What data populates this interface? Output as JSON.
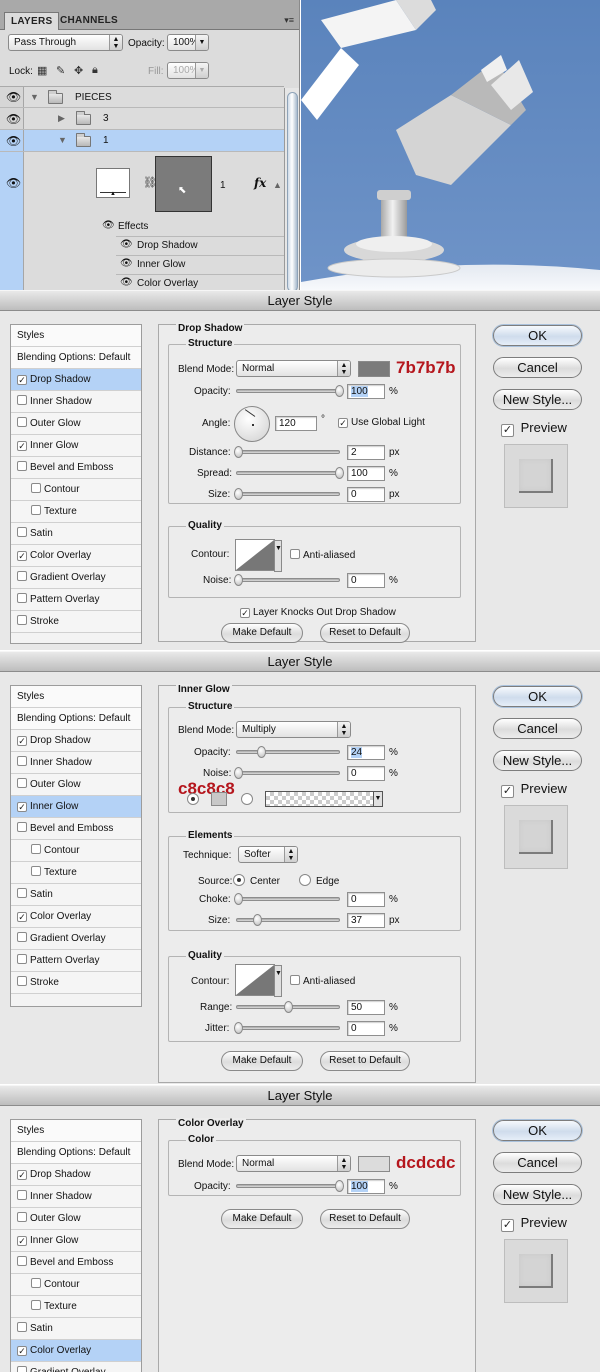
{
  "layers_panel": {
    "tabs": [
      "LAYERS",
      "CHANNELS"
    ],
    "menu_icon": "▾≡",
    "blend_mode": "Pass Through",
    "opacity_label": "Opacity:",
    "opacity_value": "100%",
    "lock_label": "Lock:",
    "fill_label": "Fill:",
    "fill_value": "100%",
    "layers": [
      {
        "name": "PIECES"
      },
      {
        "name": "3"
      },
      {
        "name": "1"
      },
      {
        "name": "1"
      }
    ],
    "effects_label": "Effects",
    "effects": [
      "Drop Shadow",
      "Inner Glow",
      "Color Overlay"
    ],
    "fx_label": "fx"
  },
  "styles_list": [
    {
      "label": "Styles",
      "checkbox": false
    },
    {
      "label": "Blending Options: Default",
      "checkbox": false
    },
    {
      "label": "Drop Shadow",
      "checkbox": true
    },
    {
      "label": "Inner Shadow",
      "checkbox": true
    },
    {
      "label": "Outer Glow",
      "checkbox": true
    },
    {
      "label": "Inner Glow",
      "checkbox": true
    },
    {
      "label": "Bevel and Emboss",
      "checkbox": true
    },
    {
      "label": "Contour",
      "checkbox": true,
      "indent": true
    },
    {
      "label": "Texture",
      "checkbox": true,
      "indent": true
    },
    {
      "label": "Satin",
      "checkbox": true
    },
    {
      "label": "Color Overlay",
      "checkbox": true
    },
    {
      "label": "Gradient Overlay",
      "checkbox": true
    },
    {
      "label": "Pattern Overlay",
      "checkbox": true
    },
    {
      "label": "Stroke",
      "checkbox": true
    }
  ],
  "checked_styles": [
    "Drop Shadow",
    "Inner Glow",
    "Color Overlay"
  ],
  "side_buttons": {
    "ok": "OK",
    "cancel": "Cancel",
    "new_style": "New Style...",
    "preview": "Preview"
  },
  "common": {
    "make_default": "Make Default",
    "reset_default": "Reset to Default",
    "check_mark": "✓"
  },
  "dialog1": {
    "title": "Layer Style",
    "section": "Drop Shadow",
    "structure": "Structure",
    "blend_mode_label": "Blend Mode:",
    "blend_mode": "Normal",
    "swatch_color": "#7b7b7b",
    "annotation": "7b7b7b",
    "opacity_label": "Opacity:",
    "opacity": "100",
    "angle_label": "Angle:",
    "angle": "120",
    "degree": "°",
    "use_global_light": "Use Global Light",
    "distance_label": "Distance:",
    "distance": "2",
    "spread_label": "Spread:",
    "spread": "100",
    "size_label": "Size:",
    "size": "0",
    "quality": "Quality",
    "contour_label": "Contour:",
    "anti_aliased": "Anti-aliased",
    "noise_label": "Noise:",
    "noise": "0",
    "knocks_out": "Layer Knocks Out Drop Shadow",
    "units": {
      "pct": "%",
      "px": "px"
    }
  },
  "dialog2": {
    "title": "Layer Style",
    "section": "Inner Glow",
    "structure": "Structure",
    "blend_mode_label": "Blend Mode:",
    "blend_mode": "Multiply",
    "opacity_label": "Opacity:",
    "opacity": "24",
    "noise_label": "Noise:",
    "noise": "0",
    "annotation": "c8c8c8",
    "swatch_color": "#c8c8c8",
    "elements": "Elements",
    "technique_label": "Technique:",
    "technique": "Softer",
    "source_label": "Source:",
    "center": "Center",
    "edge": "Edge",
    "choke_label": "Choke:",
    "choke": "0",
    "size_label": "Size:",
    "size": "37",
    "quality": "Quality",
    "contour_label": "Contour:",
    "anti_aliased": "Anti-aliased",
    "range_label": "Range:",
    "range": "50",
    "jitter_label": "Jitter:",
    "jitter": "0",
    "units": {
      "pct": "%",
      "px": "px"
    }
  },
  "dialog3": {
    "title": "Layer Style",
    "section": "Color Overlay",
    "color": "Color",
    "blend_mode_label": "Blend Mode:",
    "blend_mode": "Normal",
    "swatch_color": "#dcdcdc",
    "annotation": "dcdcdc",
    "opacity_label": "Opacity:",
    "opacity": "100",
    "units": {
      "pct": "%"
    }
  },
  "colors": {
    "accent_red": "#b5161d",
    "selection_blue": "#b4d2f6",
    "sky_blue": "#5b84bd"
  }
}
